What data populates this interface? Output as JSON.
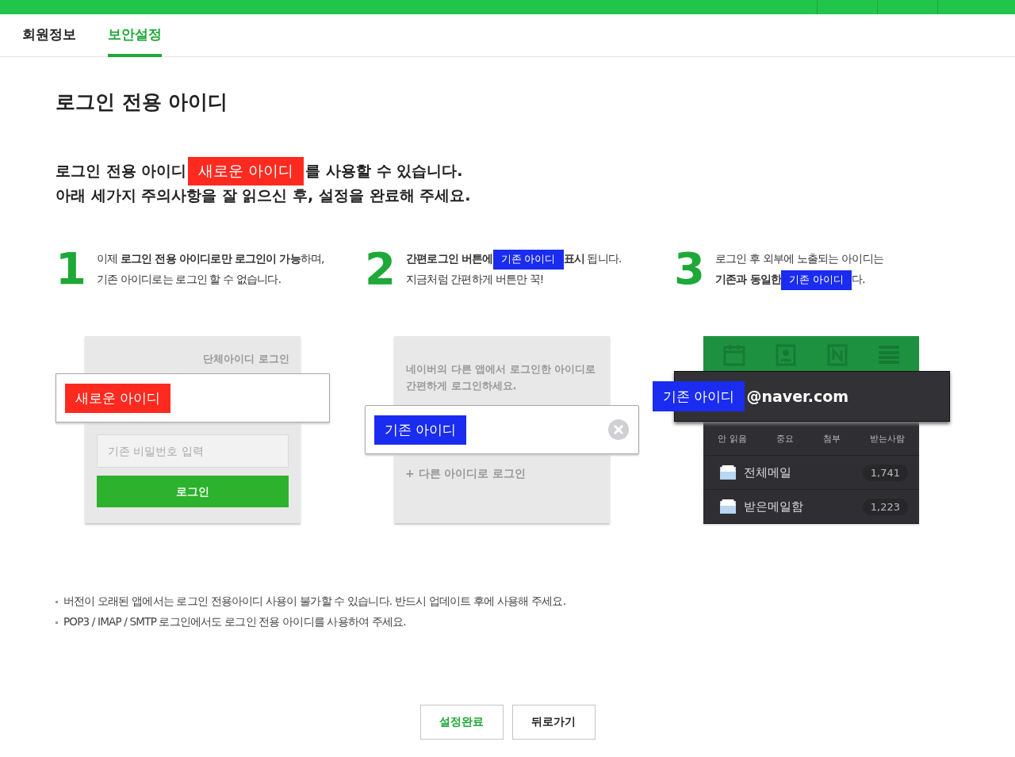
{
  "tabs": [
    {
      "label": "회원정보",
      "selected": false
    },
    {
      "label": "보안설정",
      "selected": true
    }
  ],
  "title": "로그인 전용 아이디",
  "intro": [
    [
      {
        "kind": "text",
        "text": "로그인 전용 아이디"
      },
      {
        "kind": "badge",
        "text": "새로운 아이디",
        "color": "#ff2a1f"
      },
      {
        "kind": "text",
        "text": "를 사용할 수 있습니다."
      }
    ],
    [
      {
        "kind": "text",
        "text": "아래 세가지 주의사항을 잘 읽으신 후, 설정을 완료해 주세요."
      }
    ]
  ],
  "steps": [
    {
      "number": "1",
      "lines": [
        [
          {
            "kind": "text",
            "text": "이제 **로그인 전용 아이디로만 로그인이 가능**하며,"
          }
        ],
        [
          {
            "kind": "text",
            "text": "기존 아이디로는 로그인 할 수 없습니다."
          }
        ]
      ]
    },
    {
      "number": "2",
      "lines": [
        [
          {
            "kind": "text",
            "text": "**간편로그인 버튼에**"
          },
          {
            "kind": "badge",
            "text": "기존 아이디",
            "color": "#1a2cf0"
          },
          {
            "kind": "text",
            "text": "**표시** 됩니다."
          }
        ],
        [
          {
            "kind": "text",
            "text": "지금처럼 간편하게 버튼만 꾹!"
          }
        ]
      ]
    },
    {
      "number": "3",
      "lines": [
        [
          {
            "kind": "text",
            "text": "로그인 후 외부에 노출되는 아이디는"
          }
        ],
        [
          {
            "kind": "text",
            "text": "**기존과 동일한**"
          },
          {
            "kind": "badge",
            "text": "기존 아이디",
            "color": "#1a2cf0"
          },
          {
            "kind": "text",
            "text": "다."
          }
        ]
      ]
    }
  ],
  "illustrations": [
    {
      "kind": "login_form",
      "header": "단체아이디 로그인",
      "id_badge": {
        "text": "새로운 아이디",
        "color": "#ff2a1f"
      },
      "password_placeholder": "기존 비밀번호 입력",
      "button": "로그인"
    },
    {
      "kind": "simple_login",
      "message": [
        "네이버의 다른 앱에서 로그인한 아이디로",
        "간편하게 로그인하세요."
      ],
      "id_badge": {
        "text": "기존 아이디",
        "color": "#1a2cf0"
      },
      "link": "+ 다른 아이디로 로그인"
    },
    {
      "kind": "mail_app",
      "id_badge": {
        "text": "기존 아이디",
        "color": "#1a2cf0"
      },
      "domain": "@naver.com",
      "shortcuts": [
        "안 읽음",
        "중요",
        "첨부",
        "받는사람"
      ],
      "folders": [
        {
          "name": "전체메일",
          "count": "1,741"
        },
        {
          "name": "받은메일함",
          "count": "1,223"
        }
      ]
    }
  ],
  "notes": [
    "버전이 오래된 앱에서는 로그인 전용아이디 사용이 불가할 수 있습니다. 반드시 업데이트 후에 사용해 주세요.",
    "POP3 / IMAP / SMTP 로그인에서도 로그인 전용 아이디를 사용하여 주세요."
  ],
  "buttons": [
    {
      "label": "설정완료",
      "kind": "primary"
    },
    {
      "label": "뒤로가기",
      "kind": "default"
    }
  ]
}
